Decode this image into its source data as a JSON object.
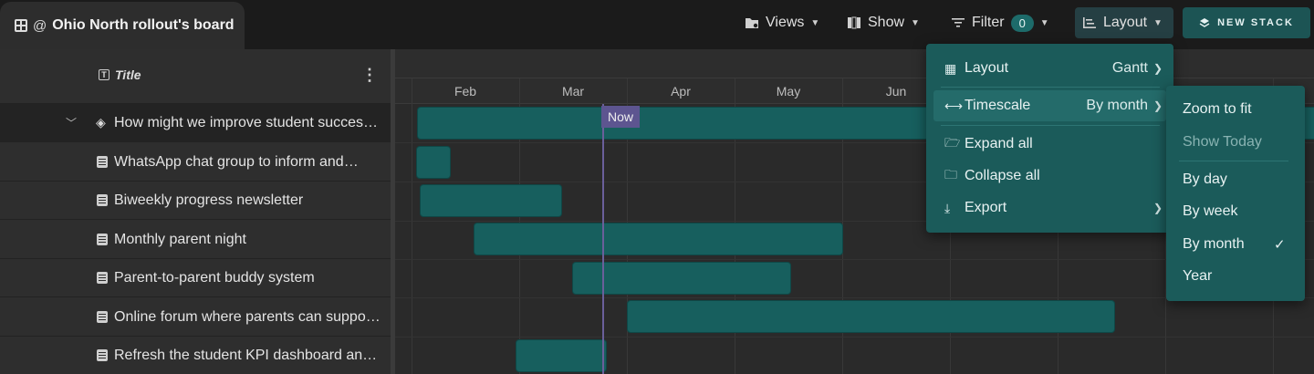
{
  "board": {
    "title": "Ohio North rollout's board",
    "at": "@"
  },
  "toolbar": {
    "views": "Views",
    "show": "Show",
    "filter": "Filter",
    "filter_count": "0",
    "layout": "Layout",
    "new_stack": "NEW STACK"
  },
  "table": {
    "column_title": "Title",
    "rows": [
      {
        "label": "How might we improve student succes…",
        "type": "parent"
      },
      {
        "label": "WhatsApp chat group to inform and…",
        "type": "doc"
      },
      {
        "label": "Biweekly progress newsletter",
        "type": "doc"
      },
      {
        "label": "Monthly parent night",
        "type": "doc"
      },
      {
        "label": "Parent-to-parent buddy system",
        "type": "doc"
      },
      {
        "label": "Online forum where parents can suppo…",
        "type": "doc"
      },
      {
        "label": "Refresh the student KPI dashboard an…",
        "type": "doc"
      }
    ]
  },
  "gantt": {
    "months": [
      "Feb",
      "Mar",
      "Apr",
      "May",
      "Jun"
    ],
    "now_label": "Now"
  },
  "layout_menu": {
    "layout_label": "Layout",
    "layout_value": "Gantt",
    "timescale_label": "Timescale",
    "timescale_value": "By month",
    "expand_all": "Expand all",
    "collapse_all": "Collapse all",
    "export": "Export"
  },
  "timescale_menu": {
    "zoom_to_fit": "Zoom to fit",
    "show_today": "Show Today",
    "by_day": "By day",
    "by_week": "By week",
    "by_month": "By month",
    "year": "Year",
    "selected": "By month"
  },
  "colors": {
    "accent": "#1b5b5a",
    "bar": "#175f5e",
    "now": "#5d5590",
    "background": "#2b2b2b"
  }
}
